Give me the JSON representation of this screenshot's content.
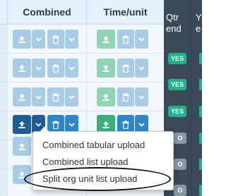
{
  "table": {
    "headers": {
      "combined": "Combined",
      "time_unit": "Time/unit"
    },
    "rows": [
      {
        "state": "faded"
      },
      {
        "state": "faded"
      },
      {
        "state": "faded"
      },
      {
        "state": "active"
      },
      {
        "state": "faded"
      },
      {
        "state": "faded"
      }
    ]
  },
  "right_panel": {
    "header_qtr_end": "Qtr end",
    "header_y": "Y",
    "header_y_line2": "e",
    "badges": [
      "YES",
      "YES",
      "YES",
      "O",
      "O",
      "O"
    ]
  },
  "dropdown_menu": {
    "items": [
      {
        "label": "Combined tabular upload"
      },
      {
        "label": "Combined list upload"
      },
      {
        "label": "Split org unit list upload",
        "highlighted": true
      }
    ]
  },
  "colors": {
    "header_bg": "#e6f0fb",
    "button_blue_active": "#2e86c9",
    "button_blue_dark": "#1f5d96",
    "button_green": "#3ab07b",
    "yes_badge": "#21b38a",
    "right_panel_bg": "#3b4a59"
  }
}
